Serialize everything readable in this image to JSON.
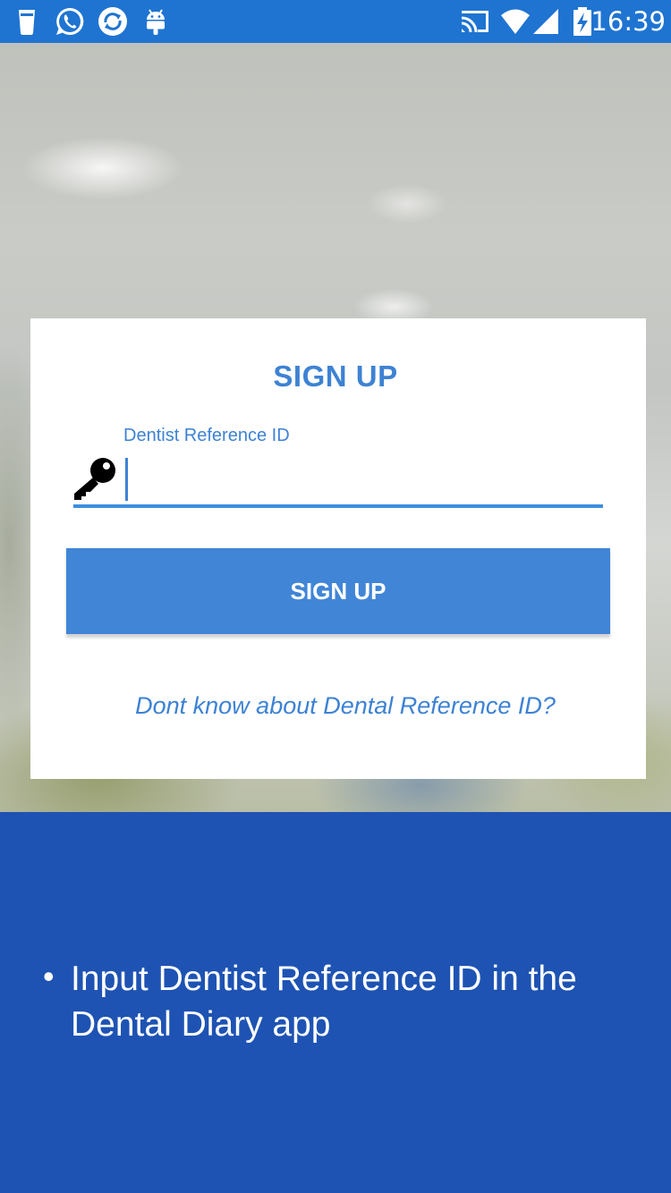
{
  "status_bar": {
    "time": "16:39",
    "left_icons": [
      "glass-icon",
      "whatsapp-icon",
      "sync-icon",
      "android-icon"
    ],
    "right_icons": [
      "cast-icon",
      "wifi-icon",
      "cell-signal-icon",
      "battery-charging-icon"
    ]
  },
  "card": {
    "title": "SIGN UP",
    "field": {
      "label": "Dentist Reference ID",
      "value": "",
      "icon": "key-icon"
    },
    "signup_button_label": "SIGN UP",
    "help_link": "Dont know about Dental Reference ID?"
  },
  "info": {
    "bullet": "•",
    "text": "Input Dentist Reference ID in the Dental Diary app"
  },
  "colors": {
    "status_bar": "#1f74d1",
    "accent": "#3d82d4",
    "button": "#4185d7",
    "info_panel": "#1e53b3"
  }
}
